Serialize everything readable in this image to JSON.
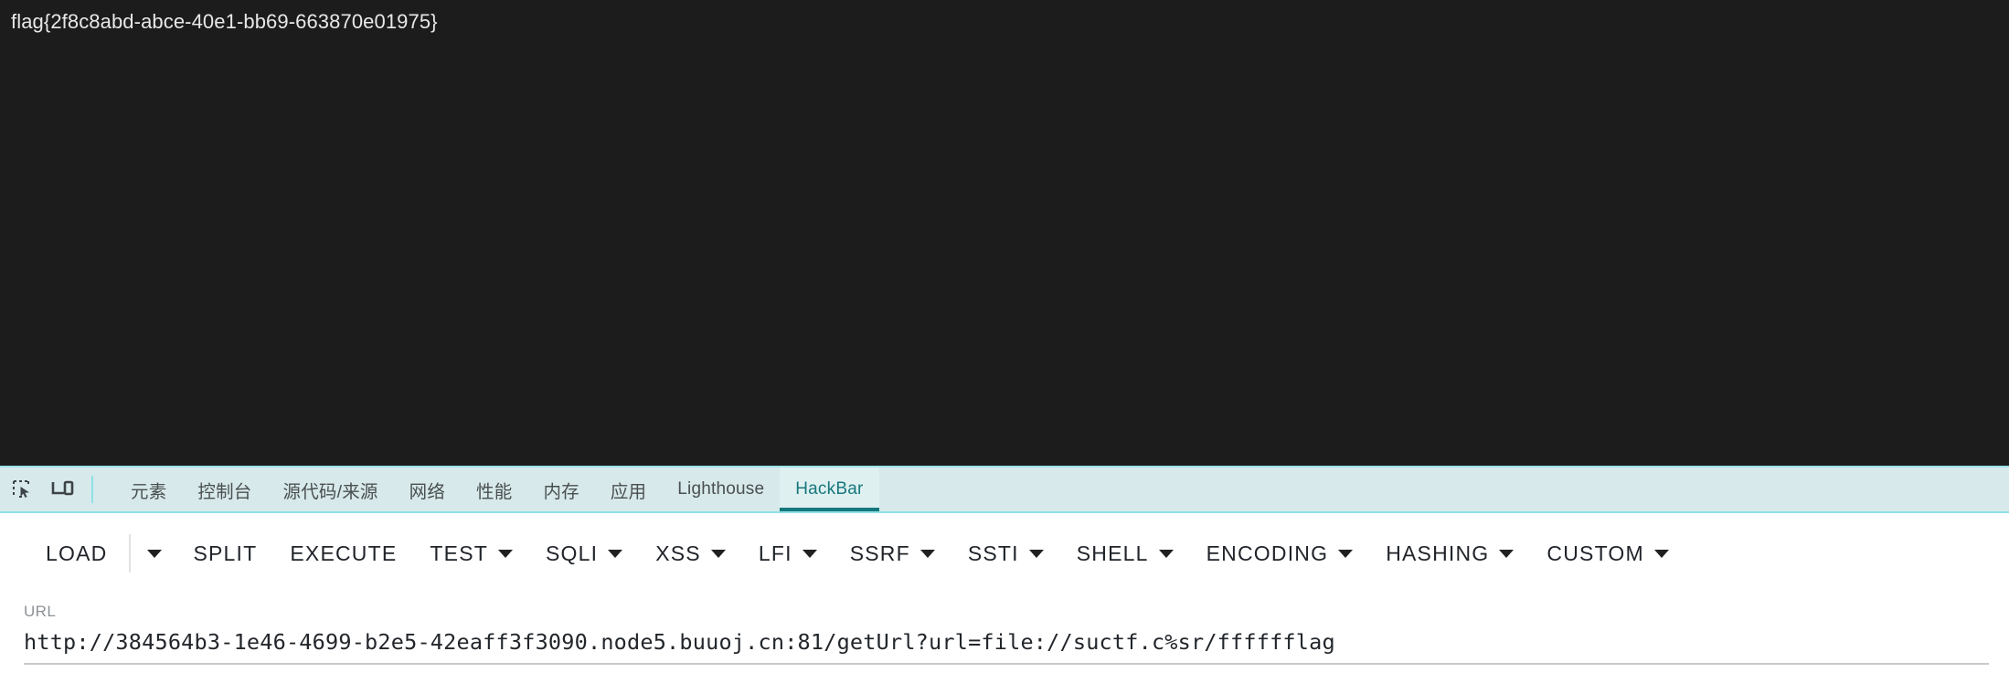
{
  "page": {
    "flag_text": "flag{2f8c8abd-abce-40e1-bb69-663870e01975}",
    "background_color": "#1c1c1c",
    "text_color": "#e8e8e8"
  },
  "devtools": {
    "accent_color": "#14787c",
    "tabbar_background": "#d7e9ea",
    "icons": [
      {
        "name": "inspect-element-icon",
        "label": "检查元素"
      },
      {
        "name": "device-toolbar-icon",
        "label": "切换设备工具栏"
      }
    ],
    "tabs": [
      {
        "label": "元素",
        "active": false,
        "cjk": true
      },
      {
        "label": "控制台",
        "active": false,
        "cjk": true
      },
      {
        "label": "源代码/来源",
        "active": false,
        "cjk": true
      },
      {
        "label": "网络",
        "active": false,
        "cjk": true
      },
      {
        "label": "性能",
        "active": false,
        "cjk": true
      },
      {
        "label": "内存",
        "active": false,
        "cjk": true
      },
      {
        "label": "应用",
        "active": false,
        "cjk": true
      },
      {
        "label": "Lighthouse",
        "active": false,
        "cjk": false
      },
      {
        "label": "HackBar",
        "active": true,
        "cjk": false
      }
    ]
  },
  "hackbar": {
    "toolbar": [
      {
        "label": "LOAD",
        "caret": false,
        "split_caret": true
      },
      {
        "label": "SPLIT",
        "caret": false,
        "split_caret": false
      },
      {
        "label": "EXECUTE",
        "caret": false,
        "split_caret": false
      },
      {
        "label": "TEST",
        "caret": true,
        "split_caret": false
      },
      {
        "label": "SQLI",
        "caret": true,
        "split_caret": false
      },
      {
        "label": "XSS",
        "caret": true,
        "split_caret": false
      },
      {
        "label": "LFI",
        "caret": true,
        "split_caret": false
      },
      {
        "label": "SSRF",
        "caret": true,
        "split_caret": false
      },
      {
        "label": "SSTI",
        "caret": true,
        "split_caret": false
      },
      {
        "label": "SHELL",
        "caret": true,
        "split_caret": false
      },
      {
        "label": "ENCODING",
        "caret": true,
        "split_caret": false
      },
      {
        "label": "HASHING",
        "caret": true,
        "split_caret": false
      },
      {
        "label": "CUSTOM",
        "caret": true,
        "split_caret": false
      }
    ],
    "url_field": {
      "label": "URL",
      "value": "http://384564b3-1e46-4699-b2e5-42eaff3f3090.node5.buuoj.cn:81/getUrl?url=file://suctf.c%sr/fffffflag",
      "placeholder": ""
    }
  }
}
